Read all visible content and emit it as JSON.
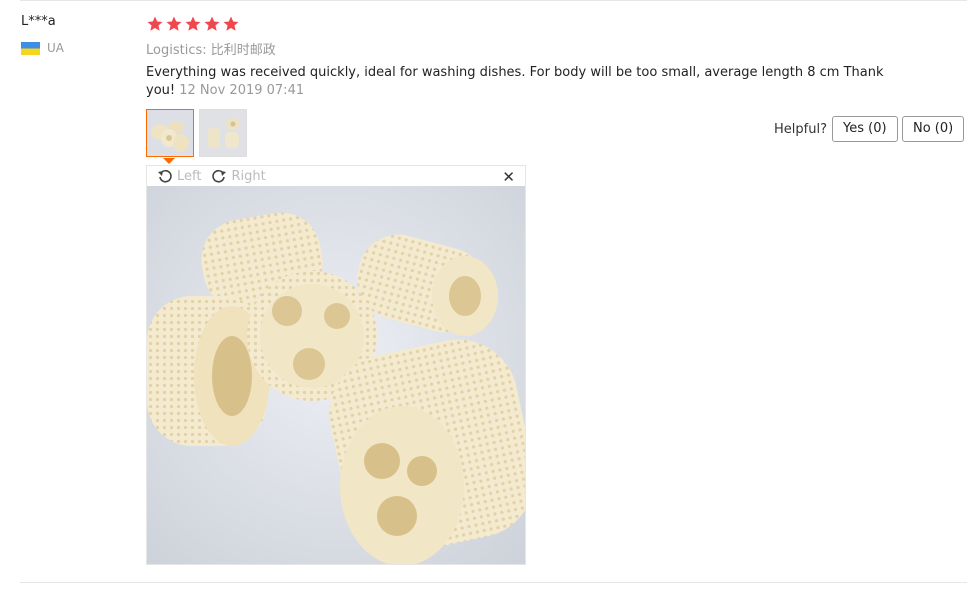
{
  "review": {
    "author": "L***a",
    "country": "UA",
    "rating": 5,
    "star_color": "#f0474d",
    "logistics": "Logistics: 比利时邮政",
    "text": "Everything was received quickly, ideal for washing dishes. For body will be too small, average length 8 cm Thank you!",
    "date": "12 Nov 2019 07:41"
  },
  "viewer": {
    "rotate_left_label": "Left",
    "rotate_right_label": "Right",
    "close_symbol": "✕"
  },
  "feedback": {
    "helpful_label": "Helpful?",
    "yes_label": "Yes (0)",
    "no_label": "No (0)"
  }
}
